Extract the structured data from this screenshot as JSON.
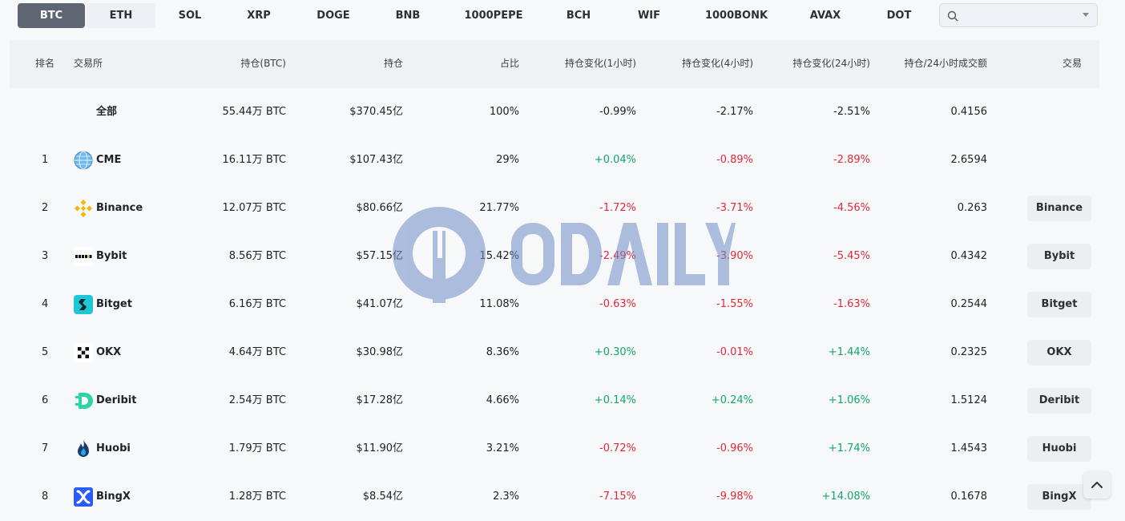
{
  "tabs": [
    "BTC",
    "ETH",
    "SOL",
    "XRP",
    "DOGE",
    "BNB",
    "1000PEPE",
    "BCH",
    "WIF",
    "1000BONK",
    "AVAX",
    "DOT"
  ],
  "search": {
    "placeholder": "",
    "value": ""
  },
  "table": {
    "headers": {
      "rank": "排名",
      "exchange": "交易所",
      "oi_btc": "持仓(BTC)",
      "oi": "持仓",
      "share": "占比",
      "chg1h": "持仓变化(1小时)",
      "chg4h": "持仓变化(4小时)",
      "chg24h": "持仓变化(24小时)",
      "ratio": "持仓/24小时成交额",
      "trade": "交易"
    },
    "total": {
      "name": "全部",
      "oi_btc": "55.44万 BTC",
      "oi": "$370.45亿",
      "share": "100%",
      "chg1h": "-0.99%",
      "chg4h": "-2.17%",
      "chg24h": "-2.51%",
      "ratio": "0.4156"
    },
    "rows": [
      {
        "rank": "1",
        "name": "CME",
        "logo": "globe-icon",
        "oi_btc": "16.11万 BTC",
        "oi": "$107.43亿",
        "share": "29%",
        "chg1h": "+0.04%",
        "chg4h": "-0.89%",
        "chg24h": "-2.89%",
        "ratio": "2.6594",
        "trade": ""
      },
      {
        "rank": "2",
        "name": "Binance",
        "logo": "binance-logo",
        "oi_btc": "12.07万 BTC",
        "oi": "$80.66亿",
        "share": "21.77%",
        "chg1h": "-1.72%",
        "chg4h": "-3.71%",
        "chg24h": "-4.56%",
        "ratio": "0.263",
        "trade": "Binance"
      },
      {
        "rank": "3",
        "name": "Bybit",
        "logo": "bybit-logo",
        "oi_btc": "8.56万 BTC",
        "oi": "$57.15亿",
        "share": "15.42%",
        "chg1h": "-2.49%",
        "chg4h": "-3.90%",
        "chg24h": "-5.45%",
        "ratio": "0.4342",
        "trade": "Bybit"
      },
      {
        "rank": "4",
        "name": "Bitget",
        "logo": "bitget-logo",
        "oi_btc": "6.16万 BTC",
        "oi": "$41.07亿",
        "share": "11.08%",
        "chg1h": "-0.63%",
        "chg4h": "-1.55%",
        "chg24h": "-1.63%",
        "ratio": "0.2544",
        "trade": "Bitget"
      },
      {
        "rank": "5",
        "name": "OKX",
        "logo": "okx-logo",
        "oi_btc": "4.64万 BTC",
        "oi": "$30.98亿",
        "share": "8.36%",
        "chg1h": "+0.30%",
        "chg4h": "-0.01%",
        "chg24h": "+1.44%",
        "ratio": "0.2325",
        "trade": "OKX"
      },
      {
        "rank": "6",
        "name": "Deribit",
        "logo": "deribit-logo",
        "oi_btc": "2.54万 BTC",
        "oi": "$17.28亿",
        "share": "4.66%",
        "chg1h": "+0.14%",
        "chg4h": "+0.24%",
        "chg24h": "+1.06%",
        "ratio": "1.5124",
        "trade": "Deribit"
      },
      {
        "rank": "7",
        "name": "Huobi",
        "logo": "huobi-logo",
        "oi_btc": "1.79万 BTC",
        "oi": "$11.90亿",
        "share": "3.21%",
        "chg1h": "-0.72%",
        "chg4h": "-0.96%",
        "chg24h": "+1.74%",
        "ratio": "1.4543",
        "trade": "Huobi"
      },
      {
        "rank": "8",
        "name": "BingX",
        "logo": "bingx-logo",
        "oi_btc": "1.28万 BTC",
        "oi": "$8.54亿",
        "share": "2.3%",
        "chg1h": "-7.15%",
        "chg4h": "-9.98%",
        "chg24h": "+14.08%",
        "ratio": "0.1678",
        "trade": "BingX"
      }
    ]
  },
  "watermark": {
    "text": "ODAILY"
  },
  "colors": {
    "positive": "#13a56e",
    "negative": "#e0283a",
    "active_tab": "#5e6673"
  }
}
